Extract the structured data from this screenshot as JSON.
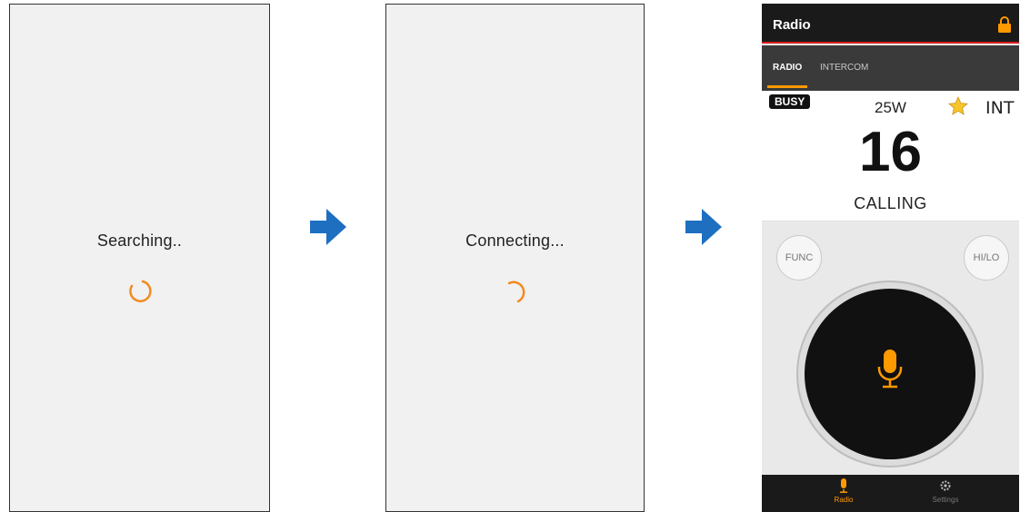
{
  "screen1": {
    "status": "Searching.."
  },
  "screen2": {
    "status": "Connecting..."
  },
  "radio_app": {
    "title": "Radio",
    "tabs": [
      "RADIO",
      "INTERCOM"
    ],
    "active_tab": "RADIO",
    "busy_badge": "BUSY",
    "power": "25W",
    "favorite_icon": "star-icon",
    "mode": "INT",
    "channel": "16",
    "call_status": "CALLING",
    "buttons": {
      "func": "FUNC",
      "hilo": "HI/LO"
    },
    "ptt_icon": "microphone-icon",
    "nav": [
      {
        "label": "Radio",
        "icon": "microphone-icon",
        "active": true
      },
      {
        "label": "Settings",
        "icon": "gear-icon",
        "active": false
      }
    ]
  },
  "colors": {
    "accent": "#ff9900",
    "header_line": "#d62020",
    "arrow": "#1e6fc0",
    "dark": "#111111"
  }
}
